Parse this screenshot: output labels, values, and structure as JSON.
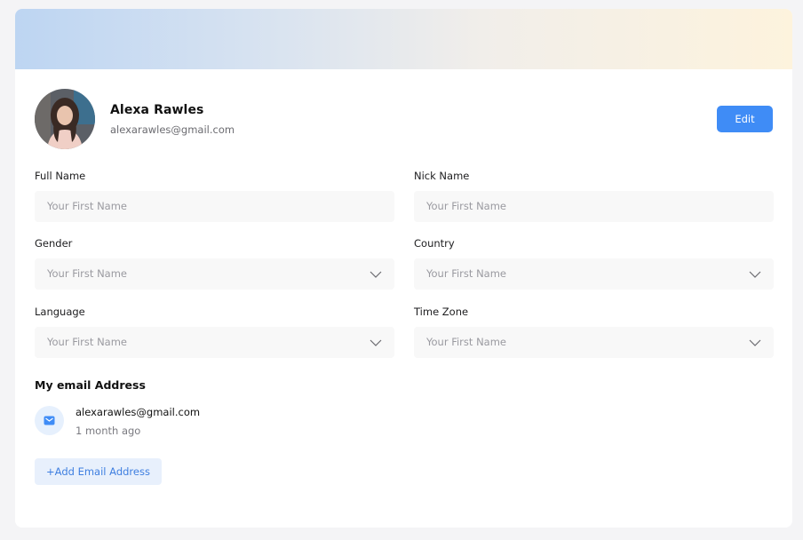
{
  "profile": {
    "name": "Alexa Rawles",
    "email": "alexarawles@gmail.com",
    "edit_label": "Edit"
  },
  "form": {
    "full_name": {
      "label": "Full Name",
      "placeholder": "Your First Name"
    },
    "nick_name": {
      "label": "Nick Name",
      "placeholder": "Your First Name"
    },
    "gender": {
      "label": "Gender",
      "placeholder": "Your First Name"
    },
    "country": {
      "label": "Country",
      "placeholder": "Your First Name"
    },
    "language": {
      "label": "Language",
      "placeholder": "Your First Name"
    },
    "time_zone": {
      "label": "Time Zone",
      "placeholder": "Your First Name"
    }
  },
  "emails": {
    "title": "My email Address",
    "items": [
      {
        "address": "alexarawles@gmail.com",
        "age": "1 month ago"
      }
    ],
    "add_label": "+Add Email Address"
  },
  "colors": {
    "accent": "#3f8cf6",
    "field_bg": "#f8f8f8",
    "add_button_bg": "#e8f0fc"
  }
}
